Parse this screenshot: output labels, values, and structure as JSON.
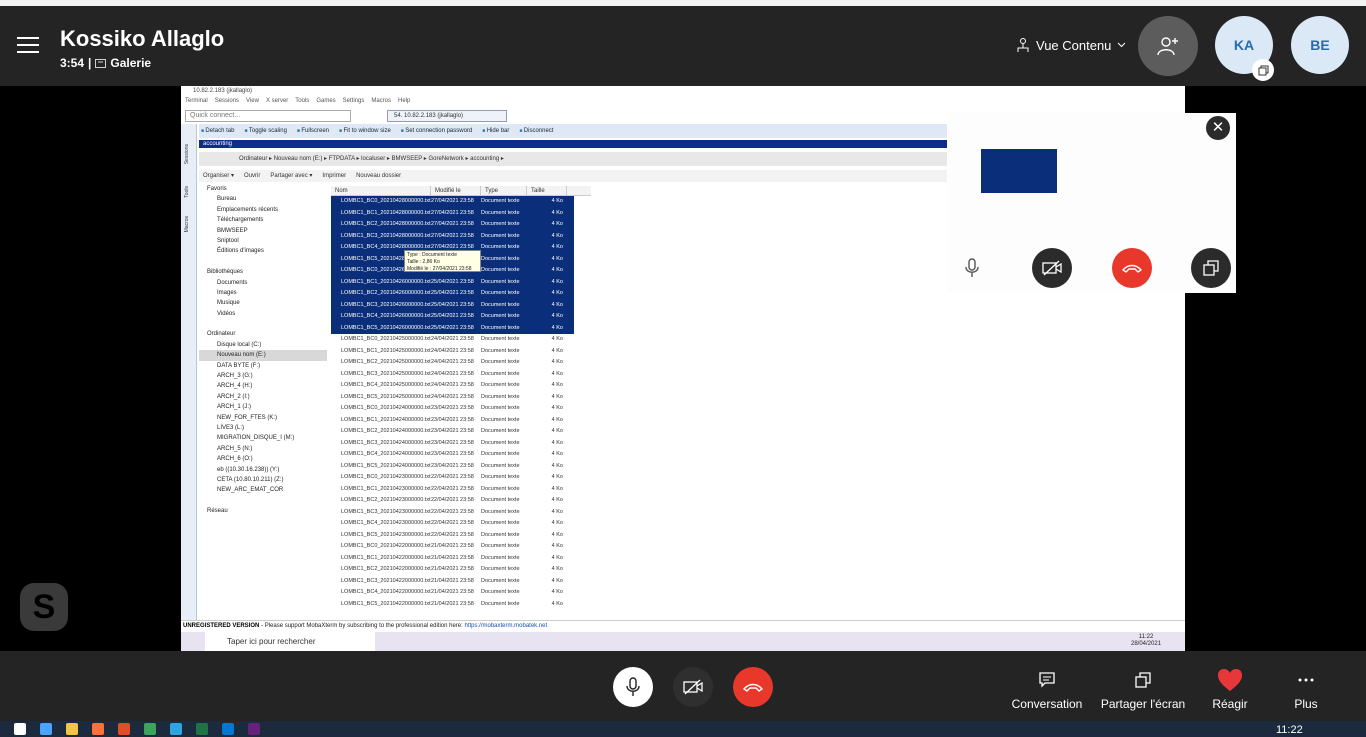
{
  "header": {
    "title": "Kossiko Allaglo",
    "timer": "3:54",
    "separator": "|",
    "view_mode": "Galerie",
    "content_view": "Vue Contenu",
    "avatars": [
      "KA",
      "BE"
    ]
  },
  "shared_screen": {
    "window_title": "10.82.2.183 (jkallaglo)",
    "menu": [
      "Terminal",
      "Sessions",
      "View",
      "X server",
      "Tools",
      "Games",
      "Settings",
      "Macros",
      "Help"
    ],
    "quick_connect_placeholder": "Quick connect...",
    "session_tab": "54. 10.82.2.183 (jkallaglo)",
    "toolbar": [
      "Detach tab",
      "Toggle scaling",
      "Fullscreen",
      "Fit to window size",
      "Set connection password",
      "Hide bar",
      "Disconnect"
    ],
    "side_tabs": [
      "Sessions",
      "Tools",
      "Macros"
    ],
    "folder_bar": "accounting",
    "address_path": "Ordinateur ▸ Nouveau nom (E:) ▸ FTPDATA ▸ localuser ▸ BMWSEEP ▸ GoreNetwork ▸ accounting ▸",
    "command_bar": [
      "Organiser ▾",
      "Ouvrir",
      "Partager avec ▾",
      "Imprimer",
      "Nouveau dossier"
    ],
    "nav_items": [
      "Favoris",
      "Bureau",
      "Emplacements récents",
      "Téléchargements",
      "BMWSEEP",
      "Sniptool",
      "Éditions d'images",
      "",
      "Bibliothèques",
      "Documents",
      "Images",
      "Musique",
      "Vidéos",
      "",
      "Ordinateur",
      "Disque local (C:)",
      "Nouveau nom (E:)",
      "DATA BYTE (F:)",
      "ARCH_3 (G:)",
      "ARCH_4 (H:)",
      "ARCH_2 (I:)",
      "ARCH_1 (J:)",
      "NEW_FOR_FTES (K:)",
      "LIVE3 (L:)",
      "MIGRATION_DISQUE_I (M:)",
      "ARCH_5 (N:)",
      "ARCH_6 (O:)",
      "eb ((10.30.16.238)) (Y:)",
      "CETA (10.80.10.211) (Z:)",
      "NEW_ARC_EMAT_COR",
      "",
      "Réseau"
    ],
    "columns": [
      "Nom",
      "Modifié le",
      "Type",
      "Taille"
    ],
    "rows": [
      {
        "name": "LOMBC1_BC0_20210428000000.txt",
        "date": "27/04/2021 23:58",
        "type": "Document texte",
        "size": "4 Ko"
      },
      {
        "name": "LOMBC1_BC1_20210428000000.txt",
        "date": "27/04/2021 23:58",
        "type": "Document texte",
        "size": "4 Ko"
      },
      {
        "name": "LOMBC1_BC2_20210428000000.txt",
        "date": "27/04/2021 23:58",
        "type": "Document texte",
        "size": "4 Ko"
      },
      {
        "name": "LOMBC1_BC3_20210428000000.txt",
        "date": "27/04/2021 23:58",
        "type": "Document texte",
        "size": "4 Ko"
      },
      {
        "name": "LOMBC1_BC4_20210428000000.txt",
        "date": "27/04/2021 23:58",
        "type": "Document texte",
        "size": "4 Ko"
      },
      {
        "name": "LOMBC1_BC5_20210428000000.txt",
        "date": "27/04/2021 23:58",
        "type": "Document texte",
        "size": "4 Ko"
      },
      {
        "name": "LOMBC1_BC0_20210426000000.txt",
        "date": "25/04/2021 23:58",
        "type": "Document texte",
        "size": "4 Ko"
      },
      {
        "name": "LOMBC1_BC1_20210426000000.txt",
        "date": "25/04/2021 23:58",
        "type": "Document texte",
        "size": "4 Ko"
      },
      {
        "name": "LOMBC1_BC2_20210426000000.txt",
        "date": "25/04/2021 23:58",
        "type": "Document texte",
        "size": "4 Ko"
      },
      {
        "name": "LOMBC1_BC3_20210426000000.txt",
        "date": "25/04/2021 23:58",
        "type": "Document texte",
        "size": "4 Ko"
      },
      {
        "name": "LOMBC1_BC4_20210426000000.txt",
        "date": "25/04/2021 23:58",
        "type": "Document texte",
        "size": "4 Ko"
      },
      {
        "name": "LOMBC1_BC5_20210426000000.txt",
        "date": "25/04/2021 23:58",
        "type": "Document texte",
        "size": "4 Ko"
      },
      {
        "name": "LOMBC1_BC0_20210425000000.txt",
        "date": "24/04/2021 23:58",
        "type": "Document texte",
        "size": "4 Ko"
      },
      {
        "name": "LOMBC1_BC1_20210425000000.txt",
        "date": "24/04/2021 23:58",
        "type": "Document texte",
        "size": "4 Ko"
      },
      {
        "name": "LOMBC1_BC2_20210425000000.txt",
        "date": "24/04/2021 23:58",
        "type": "Document texte",
        "size": "4 Ko"
      },
      {
        "name": "LOMBC1_BC3_20210425000000.txt",
        "date": "24/04/2021 23:58",
        "type": "Document texte",
        "size": "4 Ko"
      },
      {
        "name": "LOMBC1_BC4_20210425000000.txt",
        "date": "24/04/2021 23:58",
        "type": "Document texte",
        "size": "4 Ko"
      },
      {
        "name": "LOMBC1_BC5_20210425000000.txt",
        "date": "24/04/2021 23:58",
        "type": "Document texte",
        "size": "4 Ko"
      },
      {
        "name": "LOMBC1_BC0_20210424000000.txt",
        "date": "23/04/2021 23:58",
        "type": "Document texte",
        "size": "4 Ko"
      },
      {
        "name": "LOMBC1_BC1_20210424000000.txt",
        "date": "23/04/2021 23:58",
        "type": "Document texte",
        "size": "4 Ko"
      },
      {
        "name": "LOMBC1_BC2_20210424000000.txt",
        "date": "23/04/2021 23:58",
        "type": "Document texte",
        "size": "4 Ko"
      },
      {
        "name": "LOMBC1_BC3_20210424000000.txt",
        "date": "23/04/2021 23:58",
        "type": "Document texte",
        "size": "4 Ko"
      },
      {
        "name": "LOMBC1_BC4_20210424000000.txt",
        "date": "23/04/2021 23:58",
        "type": "Document texte",
        "size": "4 Ko"
      },
      {
        "name": "LOMBC1_BC5_20210424000000.txt",
        "date": "23/04/2021 23:58",
        "type": "Document texte",
        "size": "4 Ko"
      },
      {
        "name": "LOMBC1_BC0_20210423000000.txt",
        "date": "22/04/2021 23:58",
        "type": "Document texte",
        "size": "4 Ko"
      },
      {
        "name": "LOMBC1_BC1_20210423000000.txt",
        "date": "22/04/2021 23:58",
        "type": "Document texte",
        "size": "4 Ko"
      },
      {
        "name": "LOMBC1_BC2_20210423000000.txt",
        "date": "22/04/2021 23:58",
        "type": "Document texte",
        "size": "4 Ko"
      },
      {
        "name": "LOMBC1_BC3_20210423000000.txt",
        "date": "22/04/2021 23:58",
        "type": "Document texte",
        "size": "4 Ko"
      },
      {
        "name": "LOMBC1_BC4_20210423000000.txt",
        "date": "22/04/2021 23:58",
        "type": "Document texte",
        "size": "4 Ko"
      },
      {
        "name": "LOMBC1_BC5_20210423000000.txt",
        "date": "22/04/2021 23:58",
        "type": "Document texte",
        "size": "4 Ko"
      },
      {
        "name": "LOMBC1_BC0_20210422000000.txt",
        "date": "21/04/2021 23:58",
        "type": "Document texte",
        "size": "4 Ko"
      },
      {
        "name": "LOMBC1_BC1_20210422000000.txt",
        "date": "21/04/2021 23:58",
        "type": "Document texte",
        "size": "4 Ko"
      },
      {
        "name": "LOMBC1_BC2_20210422000000.txt",
        "date": "21/04/2021 23:58",
        "type": "Document texte",
        "size": "4 Ko"
      },
      {
        "name": "LOMBC1_BC3_20210422000000.txt",
        "date": "21/04/2021 23:58",
        "type": "Document texte",
        "size": "4 Ko"
      },
      {
        "name": "LOMBC1_BC4_20210422000000.txt",
        "date": "21/04/2021 23:58",
        "type": "Document texte",
        "size": "4 Ko"
      },
      {
        "name": "LOMBC1_BC5_20210422000000.txt",
        "date": "21/04/2021 23:58",
        "type": "Document texte",
        "size": "4 Ko"
      }
    ],
    "selected_rows_count": 12,
    "tooltip": [
      "Type : Document texte",
      "Taille : 2,86 Ko",
      "Modifié le : 27/04/2021 23:58"
    ],
    "unregistered_label": "UNREGISTERED VERSION",
    "unregistered_text": " - Please support MobaXterm by subscribing to the professional edition here: ",
    "unregistered_link": "https://mobaxterm.mobatek.net",
    "taskbar_search": "Taper ici pour rechercher",
    "clock_time": "11:22",
    "clock_date": "28/04/2021"
  },
  "bottom": {
    "actions": [
      "Conversation",
      "Partager l'écran",
      "Réagir",
      "Plus"
    ]
  },
  "windows_taskbar": {
    "clock": "11:22"
  },
  "colors": {
    "header_bg": "#242424",
    "hangup_red": "#e8372b",
    "avatar_bg": "#dbe9f7",
    "avatar_text": "#2a6bb0",
    "selection_blue": "#0a2e7a",
    "heart_red": "#e8373b"
  },
  "icons": [
    "hamburger-icon",
    "camera-gallery-icon",
    "share-view-icon",
    "add-person-icon",
    "popout-icon",
    "close-icon",
    "microphone-icon",
    "camera-off-icon",
    "hangup-icon",
    "conversation-icon",
    "share-screen-icon",
    "heart-icon",
    "more-icon",
    "skype-icon"
  ]
}
